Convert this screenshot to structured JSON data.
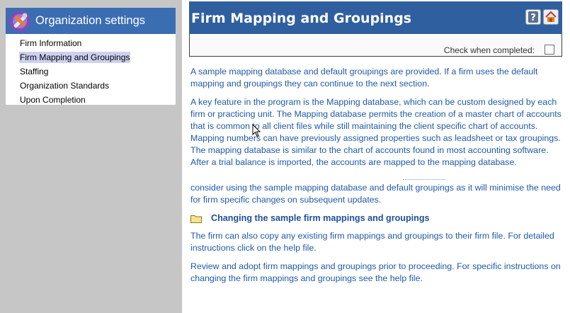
{
  "sidebar": {
    "title": "Organization settings",
    "items": [
      {
        "label": "Firm Information",
        "active": false
      },
      {
        "label": "Firm Mapping and Groupings",
        "active": true
      },
      {
        "label": "Staffing",
        "active": false
      },
      {
        "label": "Organization Standards",
        "active": false
      },
      {
        "label": "Upon Completion",
        "active": false
      }
    ]
  },
  "header": {
    "title": "Firm Mapping and Groupings",
    "help_icon": "help-icon",
    "home_icon": "home-icon",
    "check_label": "Check when completed:"
  },
  "content": {
    "p1": "A sample mapping database and default groupings are provided.  If a firm uses the default mapping and groupings they can continue to the next section.",
    "p2": "A key feature in the program is the Mapping database, which can be custom designed by each firm or practicing unit.  The Mapping database permits the creation of a master chart of accounts that is common to all client files while still maintaining the client specific chart of accounts.  Mapping numbers can have previously assigned properties such as leadsheet or tax groupings.  The mapping database is similar to the chart of accounts found in most accounting software.  After a trial balance is imported, the accounts are mapped to the mapping database.",
    "p3": "consider using the sample mapping database and default groupings as it will minimise the need for firm specific changes on subsequent updates.",
    "link": "Changing the sample firm mappings and groupings",
    "p4": "The firm can also copy any existing firm mappings and groupings to their firm file.  For detailed instructions click on the help file.",
    "p5": "Review and adopt firm mappings and groupings prior to proceeding.  For specific instructions on changing the firm mappings and groupings see the help file."
  },
  "colors": {
    "header_bg": "#2f5f9f",
    "sidebar_header_bg": "#3b6db3",
    "body_text": "#1f5aa8",
    "active_item_bg": "#cfd0f0"
  }
}
